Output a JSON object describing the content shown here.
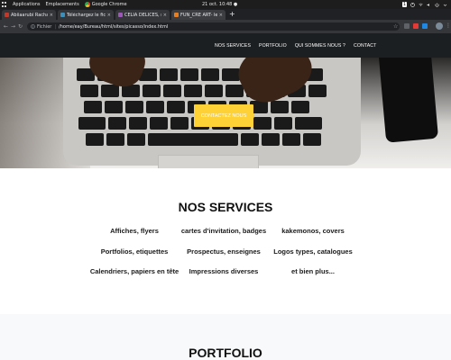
{
  "system_bar": {
    "applications": "Applications",
    "places": "Emplacements",
    "active_app": "Google Chrome",
    "clock": "21 oct.  10:48 ●",
    "workspace": "1"
  },
  "browser": {
    "tabs": [
      {
        "title": "Abiiaarubi Rachad_le dro",
        "favicon_color": "#c0392b",
        "active": false
      },
      {
        "title": "Téléchargez le fichier – ic",
        "favicon_color": "#3d8eb9",
        "active": false
      },
      {
        "title": "CELIA DELICES, restaur",
        "favicon_color": "#9b59b6",
        "active": false
      },
      {
        "title": "FUN_CRE ART- le meill",
        "favicon_color": "#e67e22",
        "active": true
      }
    ],
    "new_tab": "+",
    "address": {
      "scheme": "Fichier",
      "url": "/home/eay/Bureau/html/sites/picasso/index.html"
    }
  },
  "site": {
    "nav": [
      "NOS SERVICES",
      "PORTFOLIO",
      "QUI SOMMES NOUS ?",
      "CONTACT"
    ],
    "hero_button": "CONTACTEZ NOUS",
    "accent_color": "#fed136",
    "services": {
      "title": "NOS SERVICES",
      "items": [
        [
          "Affiches, flyers",
          "cartes d'invitation, badges",
          "kakemonos, covers"
        ],
        [
          "Portfolios, etiquettes",
          "Prospectus, enseignes",
          "Logos types, catalogues"
        ],
        [
          "Calendriers, papiers en tête",
          "Impressions diverses",
          "et bien plus..."
        ]
      ]
    },
    "portfolio": {
      "title": "PORTFOLIO"
    }
  }
}
